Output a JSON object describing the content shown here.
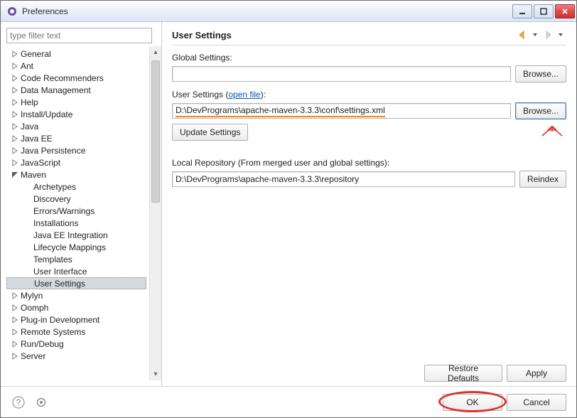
{
  "window": {
    "title": "Preferences"
  },
  "filter_placeholder": "type filter text",
  "tree": [
    {
      "label": "General",
      "depth": 0,
      "state": "col"
    },
    {
      "label": "Ant",
      "depth": 0,
      "state": "col"
    },
    {
      "label": "Code Recommenders",
      "depth": 0,
      "state": "col"
    },
    {
      "label": "Data Management",
      "depth": 0,
      "state": "col"
    },
    {
      "label": "Help",
      "depth": 0,
      "state": "col"
    },
    {
      "label": "Install/Update",
      "depth": 0,
      "state": "col"
    },
    {
      "label": "Java",
      "depth": 0,
      "state": "col"
    },
    {
      "label": "Java EE",
      "depth": 0,
      "state": "col"
    },
    {
      "label": "Java Persistence",
      "depth": 0,
      "state": "col"
    },
    {
      "label": "JavaScript",
      "depth": 0,
      "state": "col"
    },
    {
      "label": "Maven",
      "depth": 0,
      "state": "exp"
    },
    {
      "label": "Archetypes",
      "depth": 1,
      "state": "leaf"
    },
    {
      "label": "Discovery",
      "depth": 1,
      "state": "leaf"
    },
    {
      "label": "Errors/Warnings",
      "depth": 1,
      "state": "leaf"
    },
    {
      "label": "Installations",
      "depth": 1,
      "state": "leaf"
    },
    {
      "label": "Java EE Integration",
      "depth": 1,
      "state": "leaf"
    },
    {
      "label": "Lifecycle Mappings",
      "depth": 1,
      "state": "leaf"
    },
    {
      "label": "Templates",
      "depth": 1,
      "state": "leaf"
    },
    {
      "label": "User Interface",
      "depth": 1,
      "state": "leaf"
    },
    {
      "label": "User Settings",
      "depth": 1,
      "state": "leaf",
      "selected": true
    },
    {
      "label": "Mylyn",
      "depth": 0,
      "state": "col"
    },
    {
      "label": "Oomph",
      "depth": 0,
      "state": "col"
    },
    {
      "label": "Plug-in Development",
      "depth": 0,
      "state": "col"
    },
    {
      "label": "Remote Systems",
      "depth": 0,
      "state": "col"
    },
    {
      "label": "Run/Debug",
      "depth": 0,
      "state": "col"
    },
    {
      "label": "Server",
      "depth": 0,
      "state": "col"
    }
  ],
  "page": {
    "title": "User Settings",
    "global_label": "Global Settings:",
    "global_value": "",
    "user_label_prefix": "User Settings (",
    "user_link": "open file",
    "user_label_suffix": "):",
    "user_value": "D:\\DevPrograms\\apache-maven-3.3.3\\conf\\settings.xml",
    "update_btn": "Update Settings",
    "local_label": "Local Repository (From merged user and global settings):",
    "local_value": "D:\\DevPrograms\\apache-maven-3.3.3\\repository",
    "browse": "Browse...",
    "reindex": "Reindex",
    "restore": "Restore Defaults",
    "apply": "Apply"
  },
  "footer": {
    "ok": "OK",
    "cancel": "Cancel"
  }
}
